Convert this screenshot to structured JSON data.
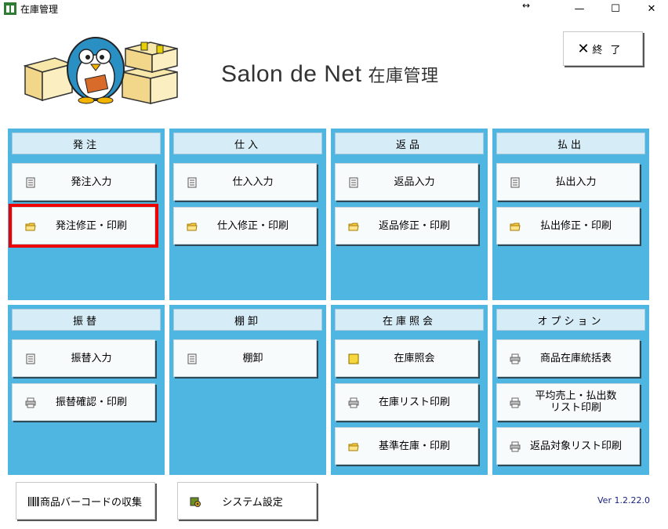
{
  "window": {
    "title": "在庫管理",
    "controls": {
      "minimize": "—",
      "maximize": "☐",
      "close": "✕",
      "resize": "↔"
    }
  },
  "header": {
    "app_name": "Salon de Net",
    "app_name_jp": "在庫管理",
    "exit_label": "終了",
    "exit_icon": "✕"
  },
  "panels": [
    {
      "title": "発注",
      "items": [
        {
          "label": "発注入力",
          "icon": "document-icon"
        },
        {
          "label": "発注修正・印刷",
          "icon": "folder-icon",
          "selected": true
        }
      ]
    },
    {
      "title": "仕入",
      "items": [
        {
          "label": "仕入入力",
          "icon": "document-icon"
        },
        {
          "label": "仕入修正・印刷",
          "icon": "folder-icon"
        }
      ]
    },
    {
      "title": "返品",
      "items": [
        {
          "label": "返品入力",
          "icon": "document-icon"
        },
        {
          "label": "返品修正・印刷",
          "icon": "folder-icon"
        }
      ]
    },
    {
      "title": "払出",
      "items": [
        {
          "label": "払出入力",
          "icon": "document-icon"
        },
        {
          "label": "払出修正・印刷",
          "icon": "folder-icon"
        }
      ]
    },
    {
      "title": "振替",
      "items": [
        {
          "label": "振替入力",
          "icon": "document-icon"
        },
        {
          "label": "振替確認・印刷",
          "icon": "printer-icon"
        }
      ]
    },
    {
      "title": "棚卸",
      "items": [
        {
          "label": "棚卸",
          "icon": "document-icon"
        }
      ]
    },
    {
      "title": "在庫照会",
      "items": [
        {
          "label": "在庫照会",
          "icon": "note-icon"
        },
        {
          "label": "在庫リスト印刷",
          "icon": "printer-icon"
        },
        {
          "label": "基準在庫・印刷",
          "icon": "folder-icon"
        }
      ]
    },
    {
      "title": "オプション",
      "items": [
        {
          "label": "商品在庫統括表",
          "icon": "printer-icon"
        },
        {
          "label": "平均売上・払出数\nリスト印刷",
          "icon": "printer-icon"
        },
        {
          "label": "返品対象リスト印刷",
          "icon": "printer-icon"
        }
      ]
    }
  ],
  "bottom": {
    "barcode_label": "商品バーコードの収集",
    "settings_label": "システム設定"
  },
  "version": "Ver 1.2.22.0",
  "colors": {
    "panel_bg": "#4fb5e1",
    "panel_header_bg": "#d6ecf7",
    "highlight": "#ee0000"
  }
}
